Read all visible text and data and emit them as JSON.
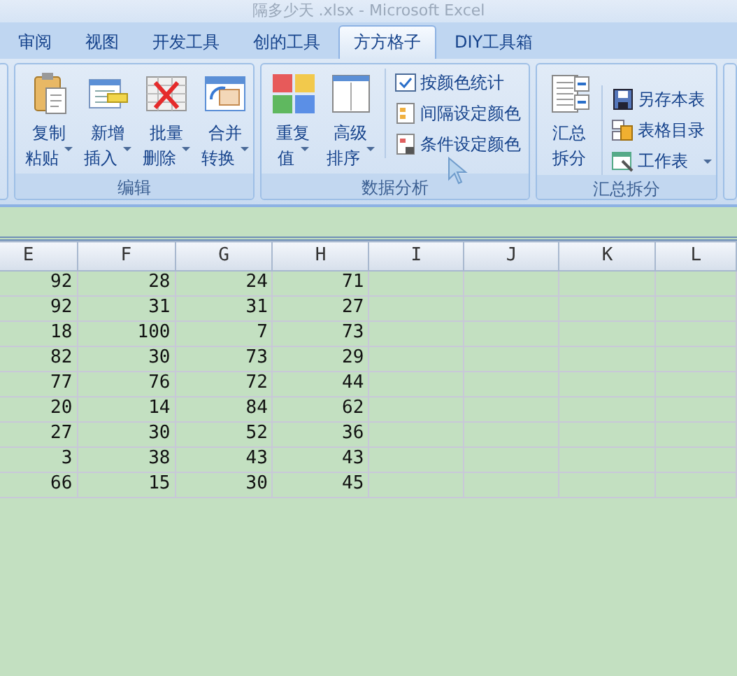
{
  "window": {
    "title": "隔多少天 .xlsx - Microsoft Excel"
  },
  "tabs": [
    {
      "label": "审阅",
      "selected": false
    },
    {
      "label": "视图",
      "selected": false
    },
    {
      "label": "开发工具",
      "selected": false
    },
    {
      "label": "创的工具",
      "selected": false
    },
    {
      "label": "方方格子",
      "selected": true
    },
    {
      "label": "DIY工具箱",
      "selected": false
    }
  ],
  "ribbon_groups": [
    {
      "label": "编辑",
      "large_buttons": [
        {
          "lines": [
            "复制",
            "粘贴"
          ],
          "dropdown": true
        },
        {
          "lines": [
            "新增",
            "插入"
          ],
          "dropdown": true
        },
        {
          "lines": [
            "批量",
            "删除"
          ],
          "dropdown": true
        },
        {
          "lines": [
            "合并",
            "转换"
          ],
          "dropdown": true
        }
      ]
    },
    {
      "label": "数据分析",
      "large_buttons": [
        {
          "lines": [
            "重复",
            "值"
          ],
          "dropdown": true
        },
        {
          "lines": [
            "高级",
            "排序"
          ],
          "dropdown": true
        }
      ],
      "small_buttons": [
        {
          "label": "按颜色统计",
          "dropdown": false
        },
        {
          "label": "间隔设定颜色",
          "dropdown": false
        },
        {
          "label": "条件设定颜色",
          "dropdown": false
        }
      ]
    },
    {
      "label": "汇总拆分",
      "large_buttons": [
        {
          "lines": [
            "汇总",
            "拆分"
          ],
          "dropdown": false
        }
      ],
      "small_buttons": [
        {
          "label": "另存本表",
          "dropdown": false
        },
        {
          "label": "表格目录",
          "dropdown": false
        },
        {
          "label": "工作表",
          "dropdown": true
        }
      ]
    }
  ],
  "sheet": {
    "columns": [
      "E",
      "F",
      "G",
      "H",
      "I",
      "J",
      "K",
      "L"
    ],
    "rows": [
      [
        "92",
        "28",
        "24",
        "71"
      ],
      [
        "92",
        "31",
        "31",
        "27"
      ],
      [
        "18",
        "100",
        "7",
        "73"
      ],
      [
        "82",
        "30",
        "73",
        "29"
      ],
      [
        "77",
        "76",
        "72",
        "44"
      ],
      [
        "20",
        "14",
        "84",
        "62"
      ],
      [
        "27",
        "30",
        "52",
        "36"
      ],
      [
        "3",
        "38",
        "43",
        "43"
      ],
      [
        "66",
        "15",
        "30",
        "45"
      ]
    ]
  }
}
